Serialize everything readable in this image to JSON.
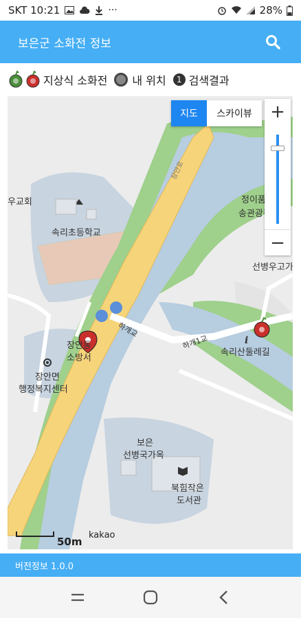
{
  "status_bar": {
    "carrier_time": "SKT 10:21",
    "battery": "28%",
    "icons": [
      "image-icon",
      "cloud-icon",
      "download-icon",
      "more-icon",
      "alarm-icon",
      "wifi-icon",
      "signal-icon",
      "battery-icon"
    ]
  },
  "app_bar": {
    "title": "보은군 소화전 정보",
    "search_icon": "search-icon"
  },
  "legend": {
    "hydrant_label": "지상식 소화전",
    "location_label": "내 위치",
    "result_number": "1",
    "result_label": "검색결과"
  },
  "map": {
    "type_map": "지도",
    "type_skyview": "스카이뷰",
    "zoom_in": "+",
    "zoom_out": "−",
    "zoom_level_fraction": 0.15,
    "labels": {
      "church": "우교회",
      "school": "속리초등학교",
      "jeongi_1": "정이품",
      "jeongi_2": "송관광청",
      "seonbyeong": "선병우고가",
      "road_jangan": "장안로",
      "bridge_1": "하개교",
      "bridge_2": "하개1교",
      "hydrant_1": "장안동",
      "hydrant_2": "소방서",
      "office_1": "장안면",
      "office_2": "행정복지센터",
      "trail": "속리산둘레길",
      "house_1": "보은",
      "house_2": "선병국가옥",
      "library_1": "북힘작은",
      "library_2": "도서관"
    },
    "scale": "50m",
    "attribution": "kakao"
  },
  "footer": {
    "version": "버전정보 1.0.0"
  },
  "nav_bar": {
    "recents_icon": "recents-icon",
    "home_icon": "home-icon",
    "back_icon": "back-icon"
  },
  "colors": {
    "app_bar": "#45aef5",
    "map_type_active": "#1e86f0",
    "road": "#f6d47a",
    "river": "#b7cde0",
    "green": "#9fd08c"
  }
}
